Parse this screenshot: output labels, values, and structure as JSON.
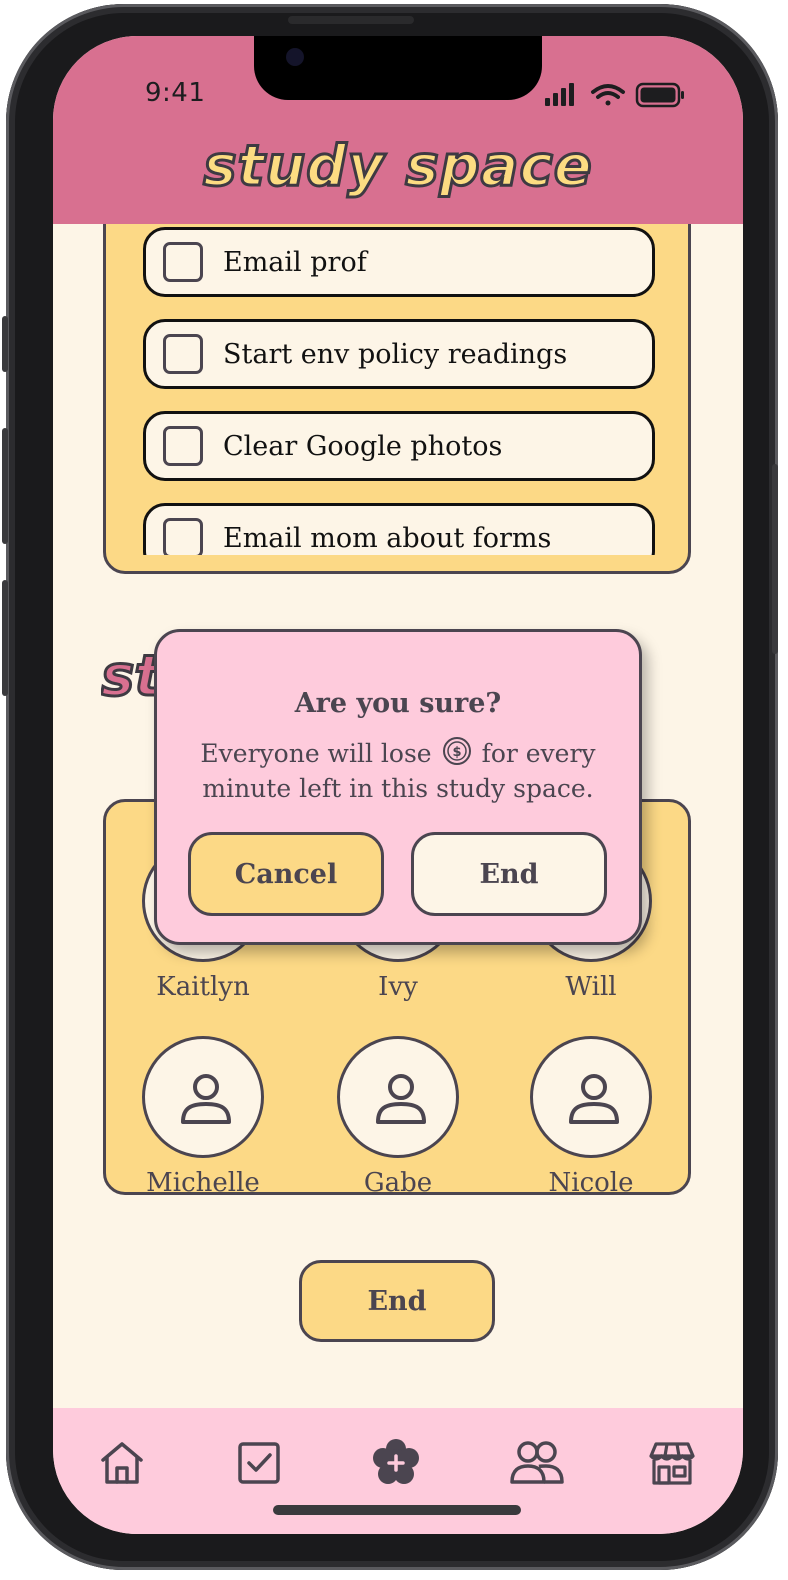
{
  "status_bar": {
    "time": "9:41"
  },
  "header": {
    "title": "study space"
  },
  "tasks": [
    {
      "label": "Email prof",
      "checked": false
    },
    {
      "label": "Start env policy readings",
      "checked": false
    },
    {
      "label": "Clear Google photos",
      "checked": false
    },
    {
      "label": "Email mom about forms",
      "checked": false
    }
  ],
  "members": {
    "heading": "study crew",
    "people": [
      {
        "name": "Kaitlyn"
      },
      {
        "name": "Ivy"
      },
      {
        "name": "Will"
      },
      {
        "name": "Michelle"
      },
      {
        "name": "Gabe"
      },
      {
        "name": "Nicole"
      }
    ]
  },
  "end_button": {
    "label": "End"
  },
  "modal": {
    "title": "Are you sure?",
    "body_before": "Everyone will lose",
    "body_after": "for every minute left in this study space.",
    "cancel_label": "Cancel",
    "end_label": "End",
    "coin_icon": "dollar-coin-icon"
  },
  "nav": {
    "items": [
      {
        "icon": "home-icon"
      },
      {
        "icon": "checklist-icon"
      },
      {
        "icon": "add-flower-icon",
        "active": true
      },
      {
        "icon": "friends-icon"
      },
      {
        "icon": "shop-icon"
      }
    ]
  },
  "colors": {
    "header_pink": "#d87090",
    "card_yellow": "#fcd986",
    "cream": "#fdf5e7",
    "modal_pink": "#fecbdc",
    "ink": "#4b4550"
  }
}
